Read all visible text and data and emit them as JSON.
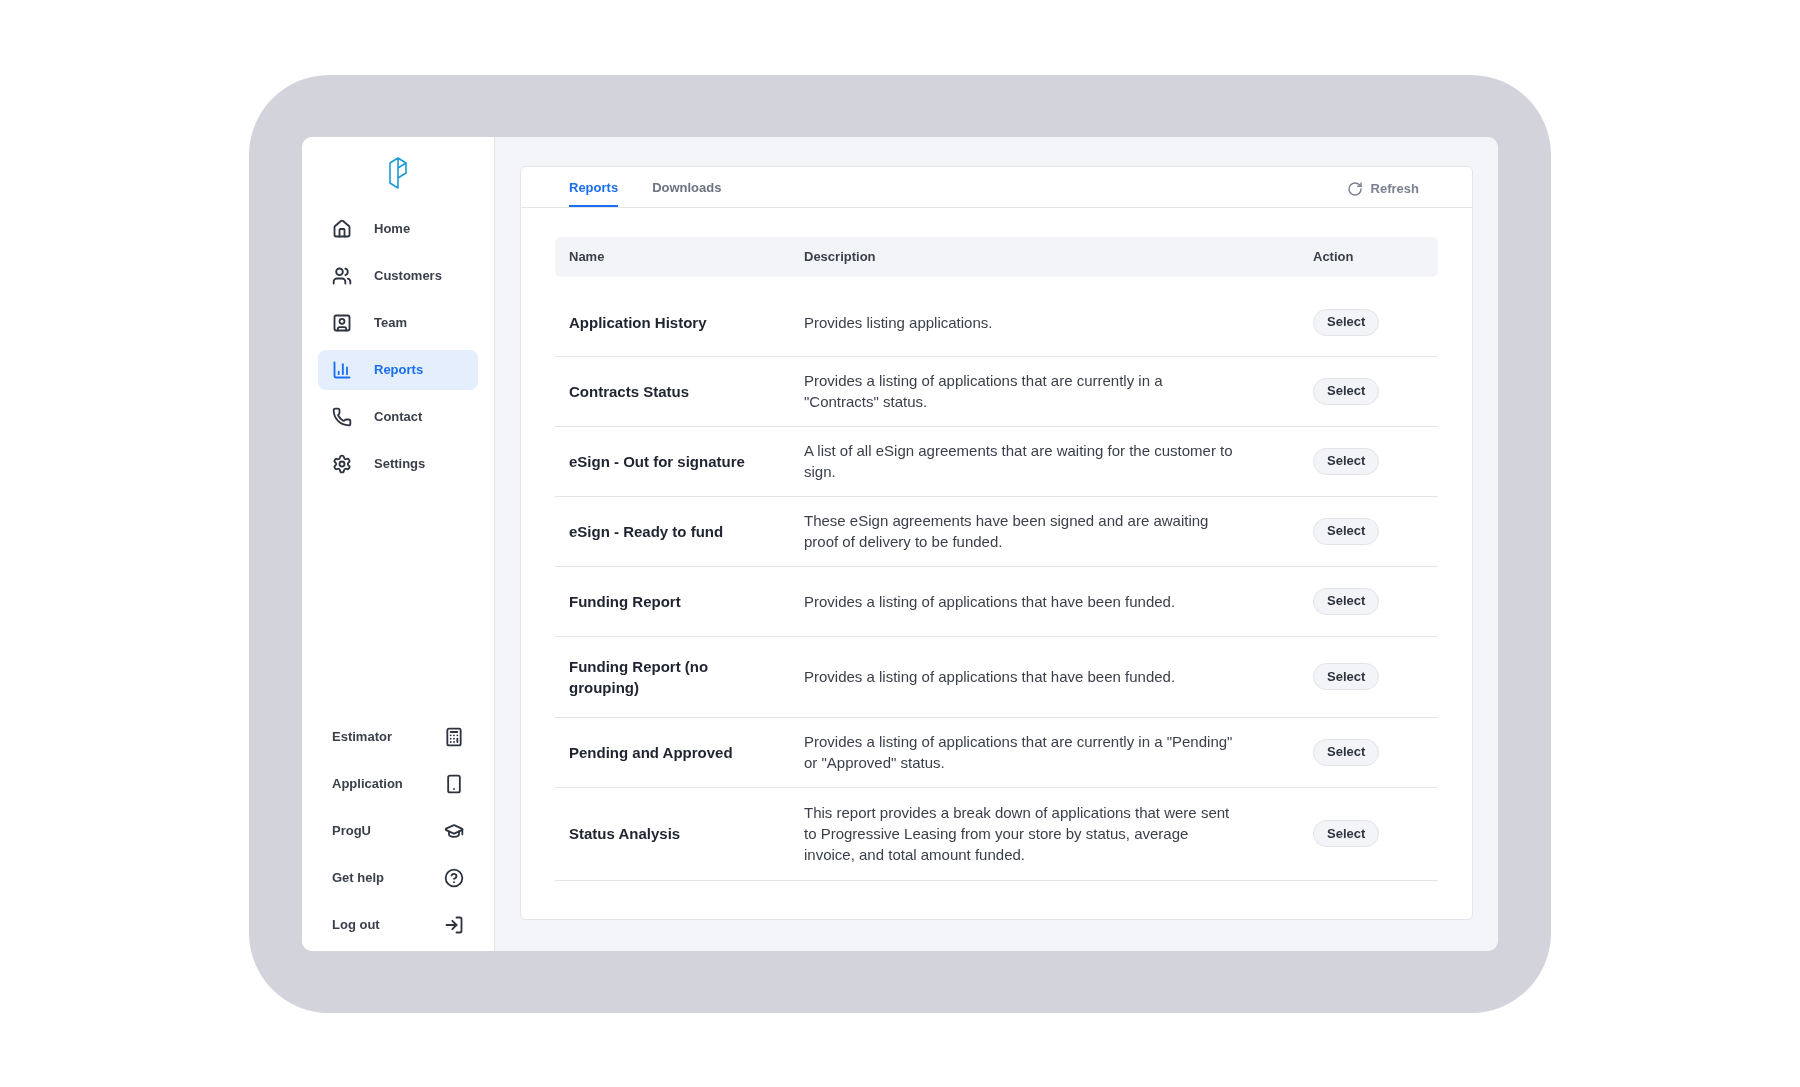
{
  "sidebar": {
    "items": [
      {
        "label": "Home",
        "selected": false
      },
      {
        "label": "Customers",
        "selected": false
      },
      {
        "label": "Team",
        "selected": false
      },
      {
        "label": "Reports",
        "selected": true
      },
      {
        "label": "Contact",
        "selected": false
      },
      {
        "label": "Settings",
        "selected": false
      }
    ],
    "footer_items": [
      {
        "label": "Estimator"
      },
      {
        "label": "Application"
      },
      {
        "label": "ProgU"
      },
      {
        "label": "Get help"
      },
      {
        "label": "Log out"
      }
    ]
  },
  "tabs": [
    {
      "label": "Reports",
      "selected": true
    },
    {
      "label": "Downloads",
      "selected": false
    }
  ],
  "refresh": "Refresh",
  "table": {
    "columns": [
      "Name",
      "Description",
      "Action"
    ],
    "rows": [
      {
        "name": "Application History",
        "description": "Provides listing applications.",
        "action": "Select"
      },
      {
        "name": "Contracts Status",
        "description": "Provides a listing of applications that are currently in a \"Contracts\" status.",
        "action": "Select"
      },
      {
        "name": "eSign - Out for signature",
        "description": "A list of all eSign agreements that are waiting for the customer to sign.",
        "action": "Select"
      },
      {
        "name": "eSign - Ready to fund",
        "description": "These eSign agreements have been signed and are awaiting proof of delivery to be funded.",
        "action": "Select"
      },
      {
        "name": "Funding Report",
        "description": "Provides a listing of applications that have been funded.",
        "action": "Select"
      },
      {
        "name": "Funding Report (no grouping)",
        "description": "Provides a listing of applications that have been funded.",
        "action": "Select"
      },
      {
        "name": "Pending and Approved",
        "description": "Provides a listing of applications that are currently in a \"Pending\" or \"Approved\" status.",
        "action": "Select"
      },
      {
        "name": "Status Analysis",
        "description": "This report provides a break down of applications that were sent to Progressive Leasing from your store by status, average invoice, and total amount funded.",
        "action": "Select"
      }
    ]
  }
}
